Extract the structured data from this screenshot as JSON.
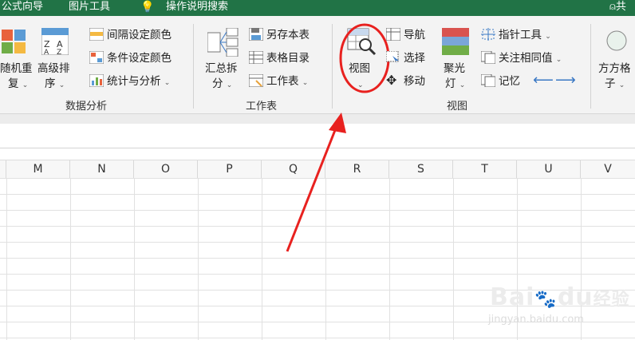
{
  "titlebar": {
    "item1": "公式向导",
    "item2": "图片工具",
    "item3": "操作说明搜索",
    "right_text": "共"
  },
  "ribbon": {
    "data_analysis": {
      "random_repeat_l1": "随机重",
      "random_repeat_l2": "复",
      "advanced_sort_l1": "高级排",
      "advanced_sort_l2": "序",
      "interval_color": "间隔设定颜色",
      "condition_color": "条件设定颜色",
      "stats_analysis": "统计与分析",
      "group_label": "数据分析"
    },
    "worksheet": {
      "summary_split_l1": "汇总拆",
      "summary_split_l2": "分",
      "save_as_table": "另存本表",
      "table_directory": "表格目录",
      "worksheet_menu": "工作表",
      "group_label": "工作表"
    },
    "view": {
      "view_label": "视图",
      "navigation": "导航",
      "select": "选择",
      "move": "移动",
      "spotlight_l1": "聚光",
      "spotlight_l2": "灯",
      "pointer_tool": "指针工具",
      "focus_same": "关注相同值",
      "memory": "记忆",
      "group_label": "视图"
    },
    "square_grid": {
      "label_l1": "方方格",
      "label_l2": "子"
    }
  },
  "columns": [
    "M",
    "N",
    "O",
    "P",
    "Q",
    "R",
    "S",
    "T",
    "U",
    "V"
  ],
  "watermark": {
    "brand": "Bai",
    "brand2": "du",
    "brand_cn": "经验",
    "url": "jingyan.baidu.com"
  },
  "colors": {
    "titlebar": "#217346",
    "annotation": "#e8211f",
    "arrow_blue": "#3a78c4"
  }
}
